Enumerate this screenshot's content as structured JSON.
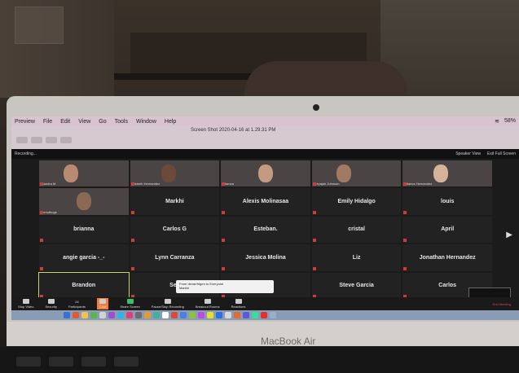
{
  "menubar": {
    "items": [
      "Preview",
      "File",
      "Edit",
      "View",
      "Go",
      "Tools",
      "Window",
      "Help"
    ],
    "battery": "58%"
  },
  "preview": {
    "title": "Screen Shot 2020-04-16 at 1.29.31 PM"
  },
  "zoom": {
    "recording": "Recording...",
    "speaker_view": "Speaker View",
    "exit_full": "Exit Full Screen",
    "tiles": [
      {
        "label": "",
        "sub": "Sandra M",
        "video": true
      },
      {
        "label": "",
        "sub": "Lisbeth Hernandez",
        "video": true
      },
      {
        "label": "",
        "sub": "Hamza",
        "video": true
      },
      {
        "label": "",
        "sub": "Keyajah Johnson",
        "video": true
      },
      {
        "label": "",
        "sub": "Bianca Hernandez",
        "video": true
      },
      {
        "label": "",
        "sub": "denuthugs",
        "video": true
      },
      {
        "label": "Markhi",
        "sub": ""
      },
      {
        "label": "Alexis Molinasaa",
        "sub": ""
      },
      {
        "label": "Emily Hidalgo",
        "sub": ""
      },
      {
        "label": "louis",
        "sub": ""
      },
      {
        "label": "brianna",
        "sub": ""
      },
      {
        "label": "Carlos G",
        "sub": ""
      },
      {
        "label": "Esteban.",
        "sub": ""
      },
      {
        "label": "cristal",
        "sub": ""
      },
      {
        "label": "April",
        "sub": ""
      },
      {
        "label": "angie garcia -_-",
        "sub": ""
      },
      {
        "label": "Lynn Carranza",
        "sub": ""
      },
      {
        "label": "Jessica Molina",
        "sub": ""
      },
      {
        "label": "Liz",
        "sub": ""
      },
      {
        "label": "Jonathan Hernandez",
        "sub": ""
      },
      {
        "label": "Brandon",
        "sub": "",
        "active": true
      },
      {
        "label": "Sev",
        "sub": ""
      },
      {
        "label": "",
        "sub": ""
      },
      {
        "label": "Steve Garcia",
        "sub": ""
      },
      {
        "label": "Carlos",
        "sub": ""
      }
    ],
    "toolbar": {
      "stop_video": "Stop Video",
      "security": "Security",
      "participants": "Participants",
      "participants_count": "24",
      "chat": "Chat",
      "share_screen": "Share Screen",
      "pause_recording": "Pause/Stop Recording",
      "breakout": "Breakout Rooms",
      "reactions": "Reactions",
      "end": "End Meeting"
    },
    "popup": {
      "text": "From devarrhtgen to Everyone",
      "sub": "Markhi"
    }
  },
  "laptop": {
    "brand": "MacBook Air"
  }
}
